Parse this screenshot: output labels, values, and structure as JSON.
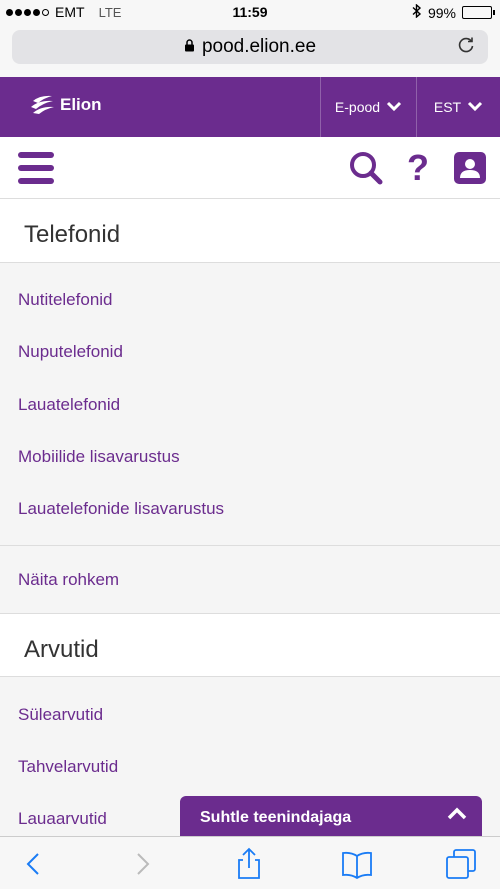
{
  "status": {
    "carrier": "EMT",
    "network": "LTE",
    "time": "11:59",
    "battery": "99%",
    "battery_level": 0.99
  },
  "browser": {
    "url": "pood.elion.ee"
  },
  "header": {
    "brand": "Elion",
    "shop_menu": "E-pood",
    "language": "EST"
  },
  "sections": [
    {
      "title": "Telefonid",
      "links": [
        "Nutitelefonid",
        "Nuputelefonid",
        "Lauatelefonid",
        "Mobiilide lisavarustus",
        "Lauatelefonide lisavarustus"
      ],
      "more": "Näita rohkem"
    },
    {
      "title": "Arvutid",
      "links": [
        "Sülearvutid",
        "Tahvelarvutid",
        "Lauaarvutid"
      ]
    }
  ],
  "chat": {
    "label": "Suhtle teenindajaga"
  },
  "colors": {
    "brand": "#6b2c8e",
    "ios_blue": "#1a7cf5"
  }
}
